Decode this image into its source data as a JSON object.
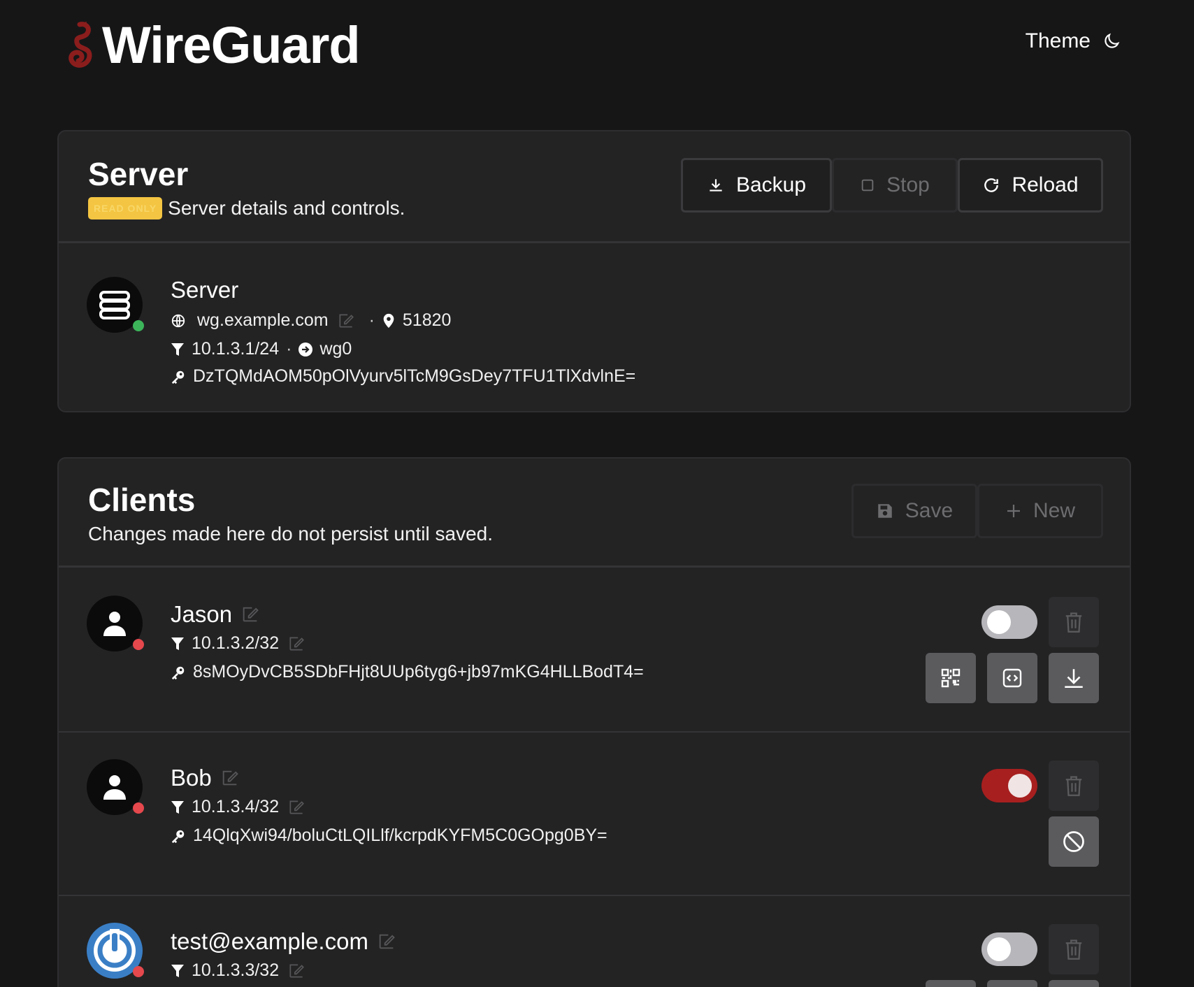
{
  "header": {
    "app_title": "WireGuard",
    "theme_label": "Theme"
  },
  "server_panel": {
    "title": "Server",
    "badge": "READ ONLY",
    "subtitle": "Server details and controls.",
    "buttons": {
      "backup": "Backup",
      "stop": "Stop",
      "reload": "Reload"
    },
    "server": {
      "name": "Server",
      "host": "wg.example.com",
      "port": "51820",
      "address": "10.1.3.1/24",
      "interface": "wg0",
      "public_key": "DzTQMdAOM50pOlVyurv5lTcM9GsDey7TFU1TlXdvlnE=",
      "status_color": "#3cb55a"
    }
  },
  "clients_panel": {
    "title": "Clients",
    "subtitle": "Changes made here do not persist until saved.",
    "buttons": {
      "save": "Save",
      "new": "New"
    },
    "clients": [
      {
        "name": "Jason",
        "address": "10.1.3.2/32",
        "public_key": "8sMOyDvCB5SDbFHjt8UUp6tyg6+jb97mKG4HLLBodT4=",
        "enabled": false,
        "actions": [
          "qr-code-icon",
          "code-config-icon",
          "download-icon"
        ]
      },
      {
        "name": "Bob",
        "address": "10.1.3.4/32",
        "public_key": "14QlqXwi94/boluCtLQILlf/kcrpdKYFM5C0GOpg0BY=",
        "enabled": true,
        "actions": [
          "blocked-icon"
        ]
      },
      {
        "name": "test@example.com",
        "address": "10.1.3.3/32",
        "enabled": false
      }
    ]
  },
  "colors": {
    "background": "#161617",
    "panel": "#232324",
    "accent_red": "#a71f1f",
    "status_green": "#3cb55a",
    "status_red": "#e5484d",
    "badge_yellow": "#f4c542"
  }
}
